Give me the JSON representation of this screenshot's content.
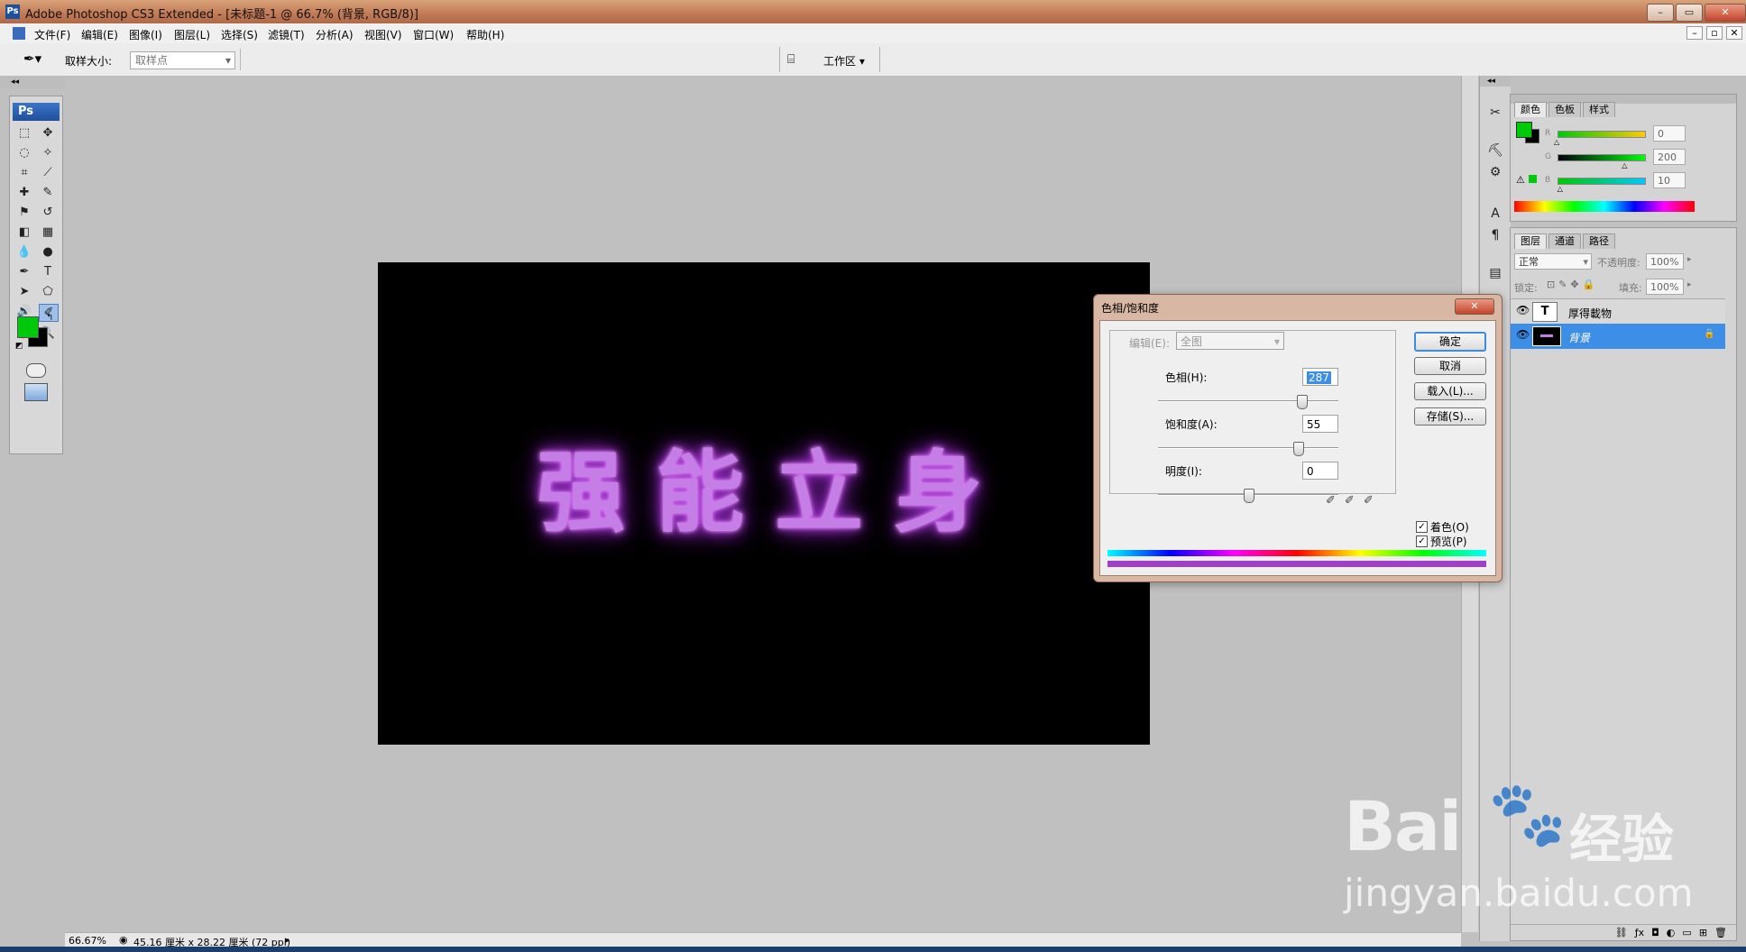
{
  "window": {
    "title": "Adobe Photoshop CS3 Extended - [未标题-1 @ 66.7% (背景, RGB/8)]",
    "app_icon": "Ps"
  },
  "window_controls": {
    "minimize": "–",
    "restore": "▭",
    "close": "✕"
  },
  "doc_controls": {
    "minimize": "–",
    "restore": "▫",
    "close": "✕"
  },
  "menu": [
    "文件(F)",
    "编辑(E)",
    "图像(I)",
    "图层(L)",
    "选择(S)",
    "滤镜(T)",
    "分析(A)",
    "视图(V)",
    "窗口(W)",
    "帮助(H)"
  ],
  "options_bar": {
    "sample_size_label": "取样大小:",
    "sample_size_value": "取样点",
    "workspace_label": "工作区 ▾"
  },
  "toolbox": {
    "logo": "Ps"
  },
  "canvas": {
    "text": "强能立身",
    "glow_color": "#c57ee6"
  },
  "status_bar": {
    "zoom": "66.67%",
    "doc_info": "45.16 厘米 x 28.22 厘米 (72 ppi)"
  },
  "color_panel": {
    "tabs": [
      "颜色",
      "色板",
      "样式"
    ],
    "active_tab": "颜色",
    "foreground_color": "#00c80a",
    "labels": [
      "R",
      "G",
      "B"
    ],
    "values": [
      "0",
      "200",
      "10"
    ],
    "fractions": [
      0.0,
      0.784,
      0.039
    ]
  },
  "layers_panel": {
    "tabs": [
      "图层",
      "通道",
      "路径"
    ],
    "active_tab": "图层",
    "blend_mode": "正常",
    "opacity_label": "不透明度:",
    "opacity": "100%",
    "lock_label": "锁定:",
    "fill_label": "填充:",
    "fill": "100%",
    "layers": [
      {
        "name": "厚得載物",
        "thumb": "T",
        "selected": false
      },
      {
        "name": "背景",
        "thumb": "",
        "selected": true
      }
    ]
  },
  "hue_sat_dialog": {
    "title": "色相/饱和度",
    "edit_label": "编辑(E):",
    "edit_value": "全图",
    "hue_label": "色相(H):",
    "hue_value": "287",
    "hue_fraction": 0.797,
    "saturation_label": "饱和度(A):",
    "saturation_value": "55",
    "saturation_fraction": 0.775,
    "lightness_label": "明度(I):",
    "lightness_value": "0",
    "lightness_fraction": 0.5,
    "buttons": {
      "ok": "确定",
      "cancel": "取消",
      "load": "载入(L)...",
      "save": "存储(S)..."
    },
    "colorize_label": "着色(O)",
    "colorize_checked": true,
    "preview_label": "预览(P)",
    "preview_checked": true,
    "result_color": "#a040c8"
  },
  "watermark": {
    "brand": "Bai",
    "brand_cn": "经验",
    "url": "jingyan.baidu.com"
  }
}
